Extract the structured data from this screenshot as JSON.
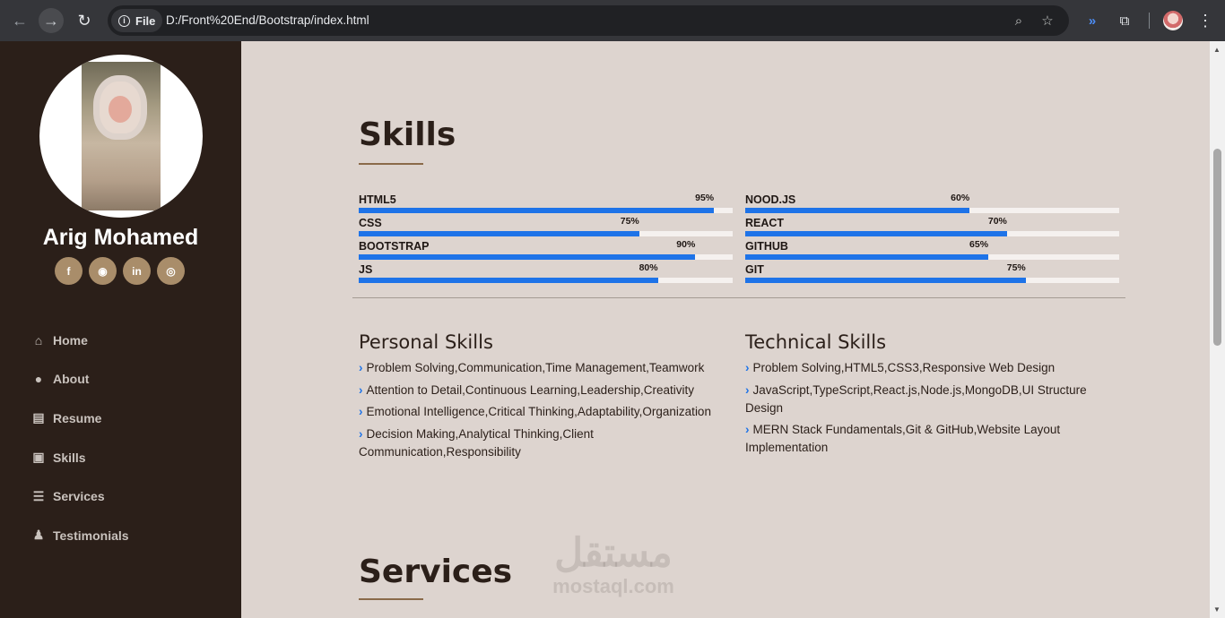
{
  "browser": {
    "back_icon": "←",
    "forward_icon": "→",
    "reload_icon": "↻",
    "chip_label": "File",
    "url": "D:/Front%20End/Bootstrap/index.html",
    "zoom_icon": "⌕",
    "star_icon": "☆",
    "ext_icon": "»",
    "puzzle_icon": "⧉",
    "menu_icon": "⋮"
  },
  "sidebar": {
    "name": "Arig Mohamed",
    "socials": [
      {
        "glyph": "f"
      },
      {
        "glyph": "◉"
      },
      {
        "glyph": "in"
      },
      {
        "glyph": "◎"
      }
    ],
    "menu": [
      {
        "label": "Home",
        "glyph": "⌂"
      },
      {
        "label": "About",
        "glyph": "●"
      },
      {
        "label": "Resume",
        "glyph": "▤"
      },
      {
        "label": "Skills",
        "glyph": "▣"
      },
      {
        "label": "Services",
        "glyph": "☰"
      },
      {
        "label": "Testimonials",
        "glyph": "♟"
      }
    ]
  },
  "skills": {
    "title": "Skills",
    "left_bars": [
      {
        "label": "HTML5",
        "pct_text": "95%",
        "value": 0.95
      },
      {
        "label": "CSS",
        "pct_text": "75%",
        "value": 0.75
      },
      {
        "label": "BOOTSTRAP",
        "pct_text": "90%",
        "value": 0.9
      },
      {
        "label": "JS",
        "pct_text": "80%",
        "value": 0.8
      }
    ],
    "right_bars": [
      {
        "label": "NOOD.JS",
        "pct_text": "60%",
        "value": 0.6
      },
      {
        "label": "REACT",
        "pct_text": "70%",
        "value": 0.7
      },
      {
        "label": "GITHUB",
        "pct_text": "65%",
        "value": 0.65
      },
      {
        "label": "GIT",
        "pct_text": "75%",
        "value": 0.75
      }
    ],
    "personal": {
      "title": "Personal Skills",
      "items": [
        "Problem Solving,Communication,Time Management,Teamwork",
        "Attention to Detail,Continuous Learning,Leadership,Creativity",
        "Emotional Intelligence,Critical Thinking,Adaptability,Organization",
        "Decision Making,Analytical Thinking,Client Communication,Responsibility"
      ]
    },
    "technical": {
      "title": "Technical Skills",
      "items": [
        "Problem Solving,HTML5,CSS3,Responsive Web Design",
        "JavaScript,TypeScript,React.js,Node.js,MongoDB,UI Structure Design",
        "MERN Stack Fundamentals,Git & GitHub,Website Layout Implementation"
      ]
    },
    "chevron": "›"
  },
  "services": {
    "title": "Services"
  },
  "watermark": {
    "arabic": "مستقل",
    "latin": "mostaql.com"
  }
}
